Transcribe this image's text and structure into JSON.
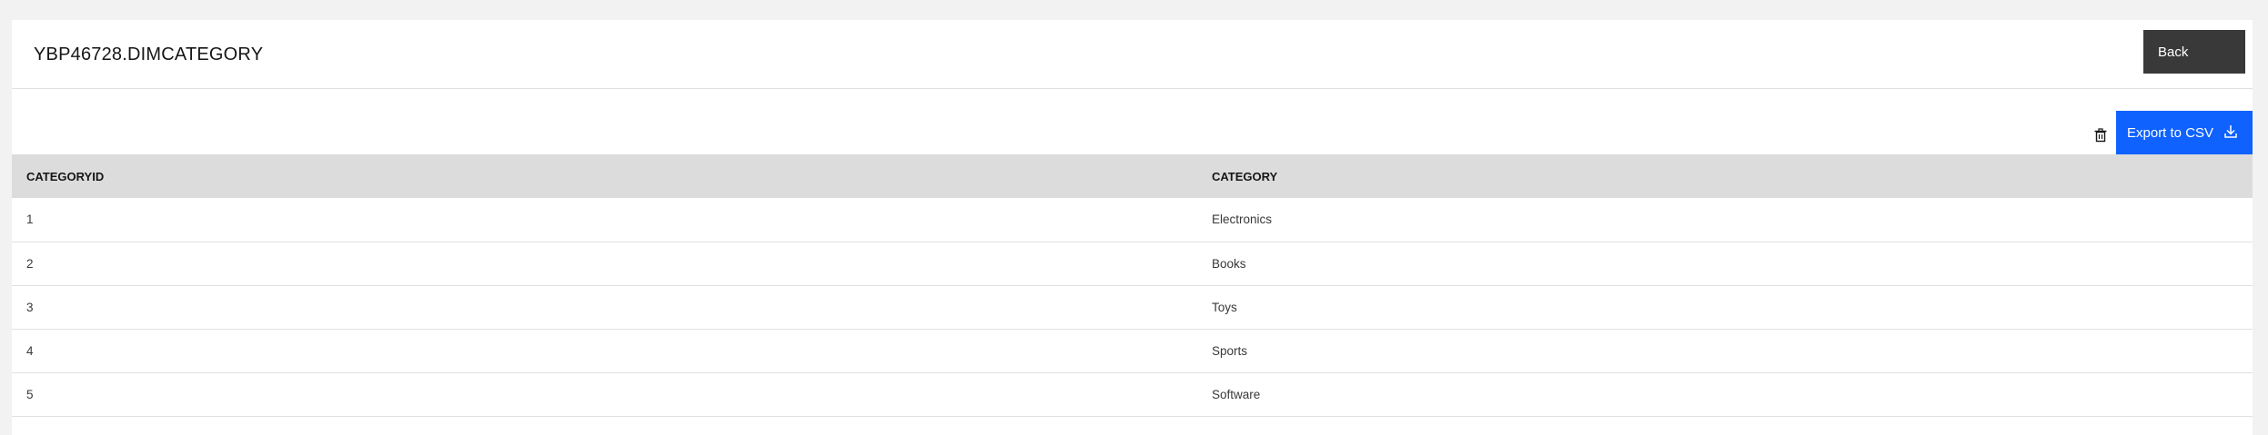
{
  "header": {
    "title": "YBP46728.DIMCATEGORY",
    "back_label": "Back"
  },
  "toolbar": {
    "delete_icon": "trash-icon",
    "export_label": "Export to CSV",
    "export_icon": "download-icon"
  },
  "table": {
    "columns": [
      "CATEGORYID",
      "CATEGORY"
    ],
    "rows": [
      [
        "1",
        "Electronics"
      ],
      [
        "2",
        "Books"
      ],
      [
        "3",
        "Toys"
      ],
      [
        "4",
        "Sports"
      ],
      [
        "5",
        "Software"
      ]
    ]
  },
  "colors": {
    "primary": "#0f62fe",
    "secondary": "#393939",
    "header_bg": "#dcdcdc"
  }
}
